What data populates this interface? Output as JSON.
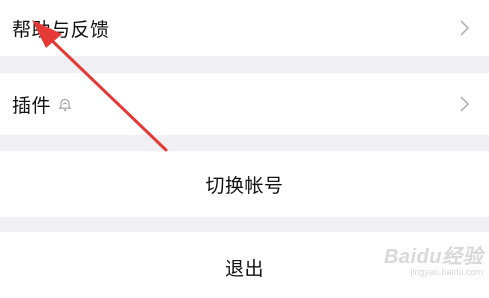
{
  "settings": {
    "help_feedback_label": "帮助与反馈",
    "plugins_label": "插件",
    "switch_account_label": "切换帐号",
    "logout_label": "退出"
  },
  "icons": {
    "chevron": "chevron-right-icon",
    "plugin": "bell-icon"
  },
  "colors": {
    "page_bg": "#efeff4",
    "row_bg": "#ffffff",
    "annotation_arrow": "#e53935"
  },
  "watermark": {
    "logo": "Baidu经验",
    "url": "jingyan.baidu.com"
  }
}
